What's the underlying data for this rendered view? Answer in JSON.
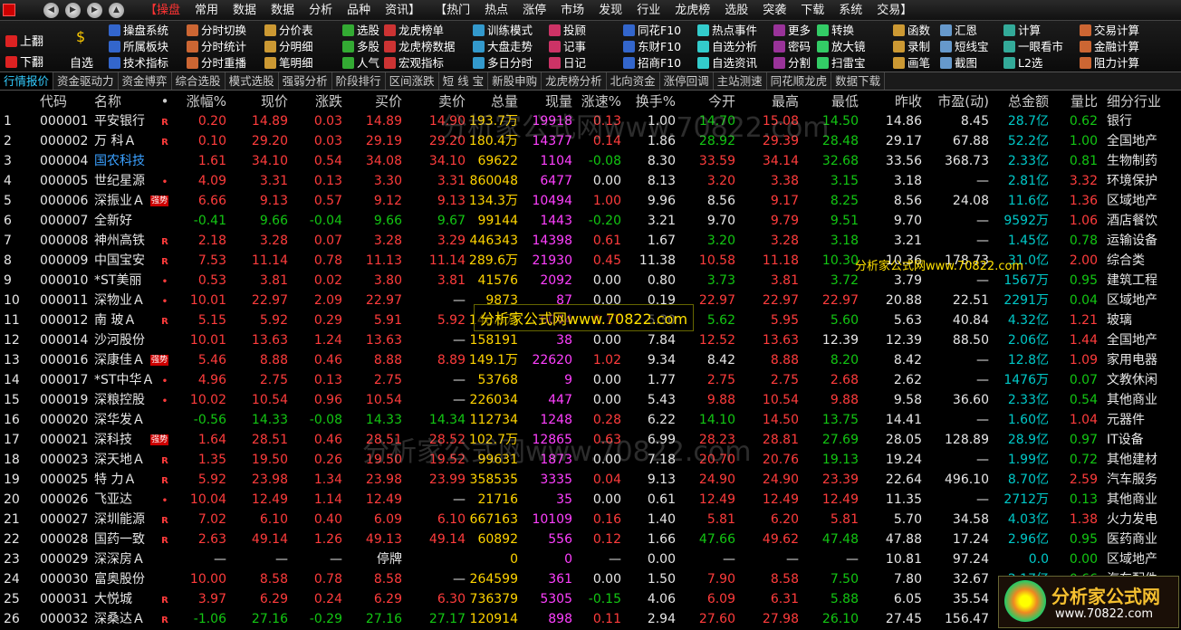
{
  "menubar": {
    "items": [
      "【操盘",
      "常用",
      "数据",
      "数据",
      "分析",
      "品种",
      "资讯】",
      "【热门",
      "热点",
      "涨停",
      "市场",
      "发现",
      "行业",
      "龙虎榜",
      "选股",
      "突袭",
      "下载",
      "系统",
      "交易】"
    ]
  },
  "toolbar": {
    "pageup": "上翻",
    "pagedown": "下翻",
    "watchlist": "自选",
    "items": [
      [
        "操盘系统",
        "分时切换",
        "分价表",
        "选股",
        "龙虎榜单",
        "训练模式",
        "投顾",
        "同花F10",
        "热点事件",
        "更多",
        "转换",
        "函数",
        "汇恩",
        "计算",
        "交易计算"
      ],
      [
        "所属板块",
        "分时统计",
        "分明细",
        "多股",
        "龙虎榜数据",
        "大盘走势",
        "记事",
        "东财F10",
        "自选分析",
        "密码",
        "放大镜",
        "录制",
        "短线宝",
        "一眼看市",
        "金融计算"
      ],
      [
        "技术指标",
        "分时重播",
        "笔明细",
        "人气",
        "宏观指标",
        "多日分时",
        "日记",
        "招商F10",
        "自选资讯",
        "分割",
        "扫雷宝",
        "画笔",
        "截图",
        "L2选",
        "阻力计算"
      ]
    ]
  },
  "tabs": [
    "行情报价",
    "资金驱动力",
    "资金博弈",
    "综合选股",
    "模式选股",
    "强弱分析",
    "阶段排行",
    "区间涨跌",
    "短 线 宝",
    "新股申购",
    "龙虎榜分析",
    "北向资金",
    "涨停回调",
    "主站测速",
    "同花顺龙虎",
    "数据下载"
  ],
  "table": {
    "headers": [
      "",
      "代码",
      "名称",
      "•",
      "涨幅%",
      "现价",
      "涨跌",
      "买价",
      "卖价",
      "总量",
      "现量",
      "涨速%",
      "换手%",
      "今开",
      "最高",
      "最低",
      "昨收",
      "市盈(动)",
      "总金额",
      "量比",
      "细分行业"
    ],
    "rows": [
      [
        "1",
        "000001",
        "平安银行",
        "R",
        "0.20",
        "14.89",
        "0.03",
        "14.89",
        "14.90",
        "193.7万",
        "19918",
        "0.13",
        "1.00",
        "14.70",
        "15.08",
        "14.50",
        "14.86",
        "8.45",
        "28.7亿",
        "0.62",
        "银行"
      ],
      [
        "2",
        "000002",
        "万 科Ａ",
        "R",
        "0.10",
        "29.20",
        "0.03",
        "29.19",
        "29.20",
        "180.4万",
        "14377",
        "0.14",
        "1.86",
        "28.92",
        "29.39",
        "28.48",
        "29.17",
        "67.88",
        "52.2亿",
        "1.00",
        "全国地产"
      ],
      [
        "3",
        "000004",
        "国农科技",
        "",
        "1.61",
        "34.10",
        "0.54",
        "34.08",
        "34.10",
        "69622",
        "1104",
        "-0.08",
        "8.30",
        "33.59",
        "34.14",
        "32.68",
        "33.56",
        "368.73",
        "2.33亿",
        "0.81",
        "生物制药"
      ],
      [
        "4",
        "000005",
        "世纪星源",
        "•",
        "4.09",
        "3.31",
        "0.13",
        "3.30",
        "3.31",
        "860048",
        "6477",
        "0.00",
        "8.13",
        "3.20",
        "3.38",
        "3.15",
        "3.18",
        "—",
        "2.81亿",
        "3.32",
        "环境保护"
      ],
      [
        "5",
        "000006",
        "深振业Ａ",
        "R",
        "6.66",
        "9.13",
        "0.57",
        "9.12",
        "9.13",
        "134.3万",
        "10494",
        "1.00",
        "9.96",
        "8.56",
        "9.17",
        "8.25",
        "8.56",
        "24.08",
        "11.6亿",
        "1.36",
        "区域地产"
      ],
      [
        "6",
        "000007",
        "全新好",
        "",
        "-0.41",
        "9.66",
        "-0.04",
        "9.66",
        "9.67",
        "99144",
        "1443",
        "-0.20",
        "3.21",
        "9.70",
        "9.79",
        "9.51",
        "9.70",
        "—",
        "9592万",
        "1.06",
        "酒店餐饮"
      ],
      [
        "7",
        "000008",
        "神州高铁",
        "R",
        "2.18",
        "3.28",
        "0.07",
        "3.28",
        "3.29",
        "446343",
        "14398",
        "0.61",
        "1.67",
        "3.20",
        "3.28",
        "3.18",
        "3.21",
        "—",
        "1.45亿",
        "0.78",
        "运输设备"
      ],
      [
        "8",
        "000009",
        "中国宝安",
        "R",
        "7.53",
        "11.14",
        "0.78",
        "11.13",
        "11.14",
        "289.6万",
        "21930",
        "0.45",
        "11.38",
        "10.58",
        "11.18",
        "10.30",
        "10.36",
        "178.73",
        "31.0亿",
        "2.00",
        "综合类"
      ],
      [
        "9",
        "000010",
        "*ST美丽",
        "•",
        "0.53",
        "3.81",
        "0.02",
        "3.80",
        "3.81",
        "41576",
        "2092",
        "0.00",
        "0.80",
        "3.73",
        "3.81",
        "3.72",
        "3.79",
        "—",
        "1567万",
        "0.95",
        "建筑工程"
      ],
      [
        "10",
        "000011",
        "深物业Ａ",
        "•",
        "10.01",
        "22.97",
        "2.09",
        "22.97",
        "—",
        "9873",
        "87",
        "0.00",
        "0.19",
        "22.97",
        "22.97",
        "22.97",
        "20.88",
        "22.51",
        "2291万",
        "0.04",
        "区域地产"
      ],
      [
        "11",
        "000012",
        "南 玻Ａ",
        "R",
        "5.15",
        "5.92",
        "0.29",
        "5.91",
        "5.92",
        "148.5万",
        "6044",
        "0.17",
        "5.30",
        "5.62",
        "5.95",
        "5.60",
        "5.63",
        "40.84",
        "4.32亿",
        "1.21",
        "玻璃"
      ],
      [
        "12",
        "000014",
        "沙河股份",
        "",
        "10.01",
        "13.63",
        "1.24",
        "13.63",
        "—",
        "158191",
        "38",
        "0.00",
        "7.84",
        "12.52",
        "13.63",
        "12.39",
        "12.39",
        "88.50",
        "2.06亿",
        "1.44",
        "全国地产"
      ],
      [
        "13",
        "000016",
        "深康佳Ａ",
        "R",
        "5.46",
        "8.88",
        "0.46",
        "8.88",
        "8.89",
        "149.1万",
        "22620",
        "1.02",
        "9.34",
        "8.42",
        "8.88",
        "8.20",
        "8.42",
        "—",
        "12.8亿",
        "1.09",
        "家用电器"
      ],
      [
        "14",
        "000017",
        "*ST中华Ａ",
        "•",
        "4.96",
        "2.75",
        "0.13",
        "2.75",
        "—",
        "53768",
        "9",
        "0.00",
        "1.77",
        "2.75",
        "2.75",
        "2.68",
        "2.62",
        "—",
        "1476万",
        "0.07",
        "文教休闲"
      ],
      [
        "15",
        "000019",
        "深粮控股",
        "•",
        "10.02",
        "10.54",
        "0.96",
        "10.54",
        "—",
        "226034",
        "447",
        "0.00",
        "5.43",
        "9.88",
        "10.54",
        "9.88",
        "9.58",
        "36.60",
        "2.33亿",
        "0.54",
        "其他商业"
      ],
      [
        "16",
        "000020",
        "深华发Ａ",
        "",
        "-0.56",
        "14.33",
        "-0.08",
        "14.33",
        "14.34",
        "112734",
        "1248",
        "0.28",
        "6.22",
        "14.10",
        "14.50",
        "13.75",
        "14.41",
        "—",
        "1.60亿",
        "1.04",
        "元器件"
      ],
      [
        "17",
        "000021",
        "深科技",
        "R",
        "1.64",
        "28.51",
        "0.46",
        "28.51",
        "28.52",
        "102.7万",
        "12865",
        "0.63",
        "6.99",
        "28.23",
        "28.81",
        "27.69",
        "28.05",
        "128.89",
        "28.9亿",
        "0.97",
        "IT设备"
      ],
      [
        "18",
        "000023",
        "深天地Ａ",
        "R",
        "1.35",
        "19.50",
        "0.26",
        "19.50",
        "19.52",
        "99631",
        "1873",
        "0.00",
        "7.18",
        "20.70",
        "20.76",
        "19.13",
        "19.24",
        "—",
        "1.99亿",
        "0.72",
        "其他建材"
      ],
      [
        "19",
        "000025",
        "特 力Ａ",
        "R",
        "5.92",
        "23.98",
        "1.34",
        "23.98",
        "23.99",
        "358535",
        "3335",
        "0.04",
        "9.13",
        "24.90",
        "24.90",
        "23.39",
        "22.64",
        "496.10",
        "8.70亿",
        "2.59",
        "汽车服务"
      ],
      [
        "20",
        "000026",
        "飞亚达",
        "•",
        "10.04",
        "12.49",
        "1.14",
        "12.49",
        "—",
        "21716",
        "35",
        "0.00",
        "0.61",
        "12.49",
        "12.49",
        "12.49",
        "11.35",
        "—",
        "2712万",
        "0.13",
        "其他商业"
      ],
      [
        "21",
        "000027",
        "深圳能源",
        "R",
        "7.02",
        "6.10",
        "0.40",
        "6.09",
        "6.10",
        "667163",
        "10109",
        "0.16",
        "1.40",
        "5.81",
        "6.20",
        "5.81",
        "5.70",
        "34.58",
        "4.03亿",
        "1.38",
        "火力发电"
      ],
      [
        "22",
        "000028",
        "国药一致",
        "R",
        "2.63",
        "49.14",
        "1.26",
        "49.13",
        "49.14",
        "60892",
        "556",
        "0.12",
        "1.66",
        "47.66",
        "49.62",
        "47.48",
        "47.88",
        "17.24",
        "2.96亿",
        "0.95",
        "医药商业"
      ],
      [
        "23",
        "000029",
        "深深房Ａ",
        "",
        "—",
        "—",
        "—",
        "停牌",
        "",
        "0",
        "0",
        "—",
        "0.00",
        "—",
        "—",
        "—",
        "10.81",
        "97.24",
        "0.0",
        "0.00",
        "区域地产"
      ],
      [
        "24",
        "000030",
        "富奥股份",
        "",
        "10.00",
        "8.58",
        "0.78",
        "8.58",
        "—",
        "264599",
        "361",
        "0.00",
        "1.50",
        "7.90",
        "8.58",
        "7.50",
        "7.80",
        "32.67",
        "2.17亿",
        "0.66",
        "汽车配件"
      ],
      [
        "25",
        "000031",
        "大悦城",
        "R",
        "3.97",
        "6.29",
        "0.24",
        "6.29",
        "6.30",
        "736379",
        "5305",
        "-0.15",
        "4.06",
        "6.09",
        "6.31",
        "5.88",
        "6.05",
        "35.54",
        "4.53亿",
        "1.28",
        "全国地产"
      ],
      [
        "26",
        "000032",
        "深桑达Ａ",
        "R",
        "-1.06",
        "27.16",
        "-0.29",
        "27.16",
        "27.17",
        "120914",
        "898",
        "0.11",
        "2.94",
        "27.60",
        "27.98",
        "26.10",
        "27.45",
        "156.47",
        "3.23亿",
        "0.97",
        "IT设备"
      ]
    ]
  },
  "badges": {
    "strong": "强势"
  },
  "watermarks": {
    "main": "分析家公式网www.70822.com",
    "small": "分析家公式网www.70822.com",
    "brand_name": "分析家公式网",
    "brand_url": "www.70822.com"
  }
}
